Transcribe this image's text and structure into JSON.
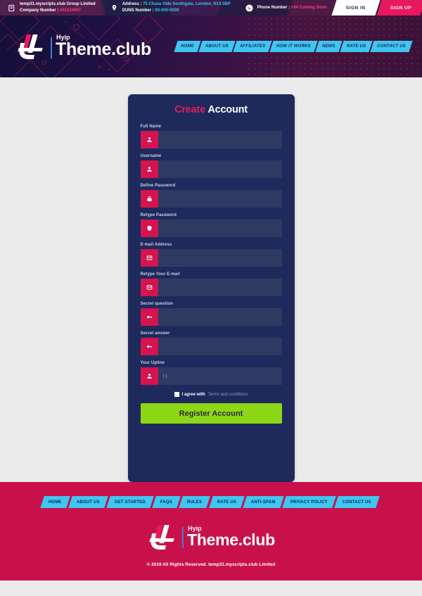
{
  "colors": {
    "crimson": "#c8114b",
    "pink": "#e8185f",
    "cyan": "#3ec6f0",
    "green": "#8ed717",
    "card_navy": "#1e2a5c",
    "input_navy": "#2f3a63",
    "page_bg": "#ebebeb"
  },
  "topbar": {
    "company": {
      "icon": "document-icon",
      "line1": "temp31.myscripts.club Group Limited",
      "line2_label": "Company Number :",
      "line2_value": "#01234567"
    },
    "address": {
      "icon": "location-pin-icon",
      "line1_label": "Address :",
      "line1_value": "75 Chase Side Southgate, London, N14 5BP",
      "line2_label": "DUNS Number :",
      "line2_value": "00-000-0000"
    },
    "phone": {
      "icon": "phone-icon",
      "label": "Phone Number :",
      "value": "+44 Coming Soon"
    },
    "sign_in": "SIGN IN",
    "sign_up": "SIGN UP"
  },
  "brand": {
    "sub": "Hyip",
    "name": "Theme.club"
  },
  "mainnav": [
    {
      "label": "HOME"
    },
    {
      "label": "ABOUT US"
    },
    {
      "label": "AFFILIATES"
    },
    {
      "label": "HOW IT WORKS"
    },
    {
      "label": "NEWS"
    },
    {
      "label": "RATE US"
    },
    {
      "label": "CONTACT US"
    }
  ],
  "form": {
    "title_accent": "Create",
    "title_rest": "Account",
    "fields": [
      {
        "label": "Full Name",
        "icon": "user-icon",
        "value": "",
        "placeholder": ""
      },
      {
        "label": "Username",
        "icon": "user-icon",
        "value": "",
        "placeholder": ""
      },
      {
        "label": "Define Password",
        "icon": "lock-icon",
        "value": "",
        "placeholder": ""
      },
      {
        "label": "Retype Password",
        "icon": "shield-icon",
        "value": "",
        "placeholder": ""
      },
      {
        "label": "E-mail Address",
        "icon": "envelope-icon",
        "value": "",
        "placeholder": ""
      },
      {
        "label": "Retype Your E-mail",
        "icon": "envelope-icon",
        "value": "",
        "placeholder": ""
      },
      {
        "label": "Secret question",
        "icon": "key-icon",
        "value": "",
        "placeholder": ""
      },
      {
        "label": "Secret answer",
        "icon": "key-icon",
        "value": "",
        "placeholder": ""
      },
      {
        "label": "Your Upline",
        "icon": "user-icon",
        "value": "( )",
        "placeholder": ""
      }
    ],
    "agree_prefix": "I agree with",
    "agree_link": "Terms and conditions",
    "submit_label": "Register Account"
  },
  "footer": {
    "nav": [
      {
        "label": "HOME"
      },
      {
        "label": "ABOUT US"
      },
      {
        "label": "GET STARTED"
      },
      {
        "label": "FAQS"
      },
      {
        "label": "RULES"
      },
      {
        "label": "RATE US"
      },
      {
        "label": "ANTI-SPAM"
      },
      {
        "label": "PRIVACY POLICY"
      },
      {
        "label": "CONTACT US"
      }
    ],
    "copyright": "© 2019 All Rights Reserved. temp31.myscripts.club Limited"
  }
}
